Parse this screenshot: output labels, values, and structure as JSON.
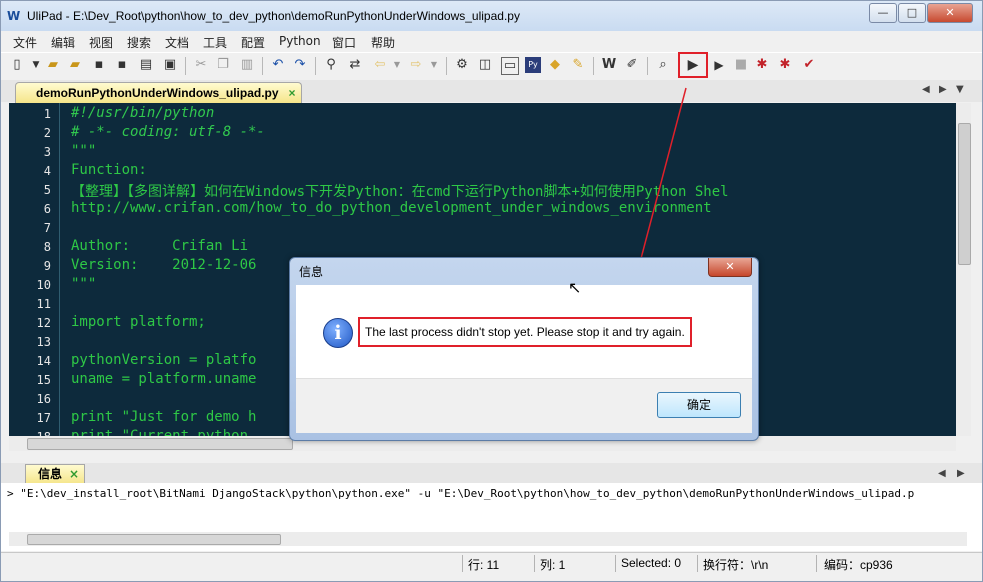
{
  "window": {
    "title": "UliPad - E:\\Dev_Root\\python\\how_to_dev_python\\demoRunPythonUnderWindows_ulipad.py",
    "app_icon": "W",
    "minimize_glyph": "—",
    "maximize_glyph": "□",
    "close_glyph": "✕"
  },
  "menu": [
    "文件",
    "编辑",
    "视图",
    "搜索",
    "文档",
    "工具",
    "配置",
    "Python",
    "窗口",
    "帮助"
  ],
  "tab": {
    "label": "demoRunPythonUnderWindows_ulipad.py",
    "close": "×"
  },
  "tab_nav": {
    "prev": "◀",
    "next": "▶",
    "menu": "▼"
  },
  "editor": {
    "line_numbers": [
      "1",
      "2",
      "3",
      "4",
      "5",
      "6",
      "7",
      "8",
      "9",
      "10",
      "11",
      "12",
      "13",
      "14",
      "15",
      "16",
      "17",
      "18"
    ],
    "lines": [
      {
        "cls": "c-com",
        "text": "#!/usr/bin/python"
      },
      {
        "cls": "c-com",
        "text": "# -*- coding: utf-8 -*-"
      },
      {
        "cls": "c-str",
        "text": "\"\"\""
      },
      {
        "cls": "c-str",
        "text": "Function:"
      },
      {
        "cls": "c-str",
        "text": "【整理】【多图详解】如何在Windows下开发Python：在cmd下运行Python脚本+如何使用Python Shel"
      },
      {
        "cls": "c-str",
        "text": "http://www.crifan.com/how_to_do_python_development_under_windows_environment"
      },
      {
        "cls": "c-str",
        "text": ""
      },
      {
        "cls": "c-str",
        "text": "Author:     Crifan Li"
      },
      {
        "cls": "c-str",
        "text": "Version:    2012-12-06"
      },
      {
        "cls": "c-str",
        "text": "\"\"\""
      },
      {
        "cls": "c-norm",
        "text": ""
      },
      {
        "cls": "c-norm",
        "text": "import platform;"
      },
      {
        "cls": "c-norm",
        "text": ""
      },
      {
        "cls": "c-norm",
        "text": "pythonVersion = platfo"
      },
      {
        "cls": "c-norm",
        "text": "uname = platform.uname"
      },
      {
        "cls": "c-norm",
        "text": ""
      },
      {
        "cls": "c-norm",
        "text": "print \"Just for demo h"
      },
      {
        "cls": "c-norm",
        "text": "print \"Current python"
      }
    ]
  },
  "info_panel": {
    "tab_label": "信息",
    "close": "×",
    "output": "> \"E:\\dev_install_root\\BitNami DjangoStack\\python\\python.exe\" -u \"E:\\Dev_Root\\python\\how_to_dev_python\\demoRunPythonUnderWindows_ulipad.p"
  },
  "status": {
    "row": "行: 11",
    "col": "列: 1",
    "selected": "Selected: 0",
    "eol": "换行符：\\r\\n",
    "encoding": "编码：cp936"
  },
  "dialog": {
    "title": "信息",
    "close": "✕",
    "icon_glyph": "i",
    "message": "The last process didn't stop yet. Please stop it and try again.",
    "ok_label": "确定"
  },
  "colors": {
    "annotation": "#e0202a",
    "editor_bg": "#0d2a3c",
    "code_green": "#2ec846"
  }
}
